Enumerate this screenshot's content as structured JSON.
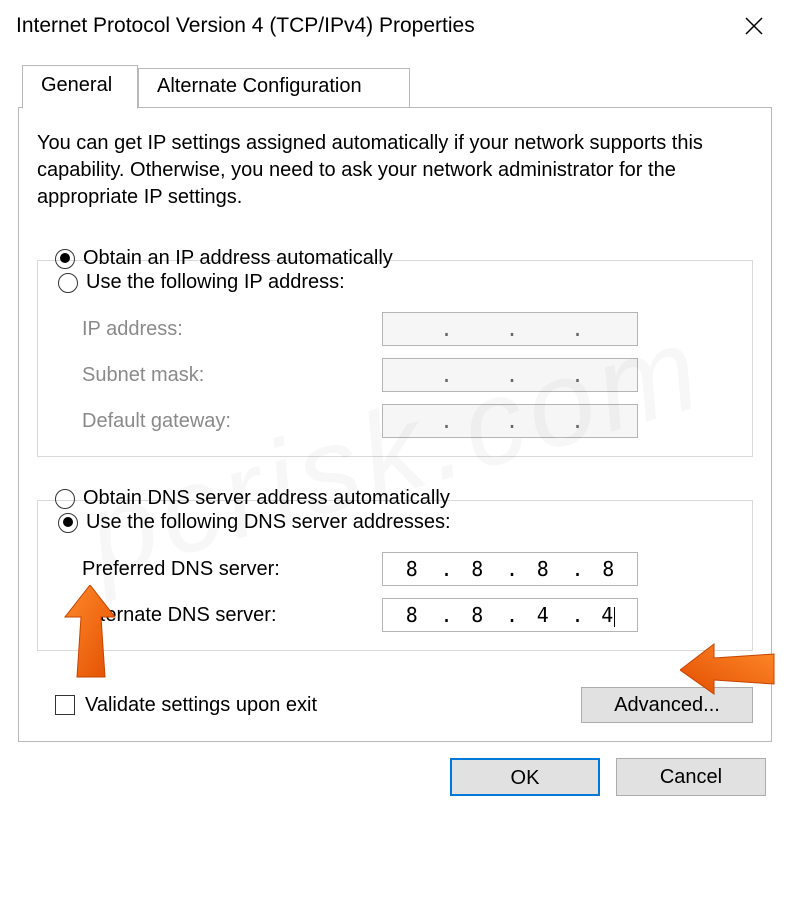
{
  "window": {
    "title": "Internet Protocol Version 4 (TCP/IPv4) Properties"
  },
  "tabs": {
    "general": "General",
    "alternate": "Alternate Configuration"
  },
  "intro": "You can get IP settings assigned automatically if your network supports this capability. Otherwise, you need to ask your network administrator for the appropriate IP settings.",
  "ip_section": {
    "auto_label": "Obtain an IP address automatically",
    "manual_label": "Use the following IP address:",
    "selected": "auto",
    "ip_address_label": "IP address:",
    "subnet_label": "Subnet mask:",
    "gateway_label": "Default gateway:",
    "ip_address": [
      "",
      "",
      "",
      ""
    ],
    "subnet": [
      "",
      "",
      "",
      ""
    ],
    "gateway": [
      "",
      "",
      "",
      ""
    ]
  },
  "dns_section": {
    "auto_label": "Obtain DNS server address automatically",
    "manual_label": "Use the following DNS server addresses:",
    "selected": "manual",
    "preferred_label": "Preferred DNS server:",
    "alternate_label": "Alternate DNS server:",
    "preferred": [
      "8",
      "8",
      "8",
      "8"
    ],
    "alternate": [
      "8",
      "8",
      "4",
      "4"
    ]
  },
  "validate_label": "Validate settings upon exit",
  "validate_checked": false,
  "buttons": {
    "advanced": "Advanced...",
    "ok": "OK",
    "cancel": "Cancel"
  },
  "watermark": "pcrisk.com",
  "annotations": {
    "arrow_color": "#ff6a13"
  }
}
